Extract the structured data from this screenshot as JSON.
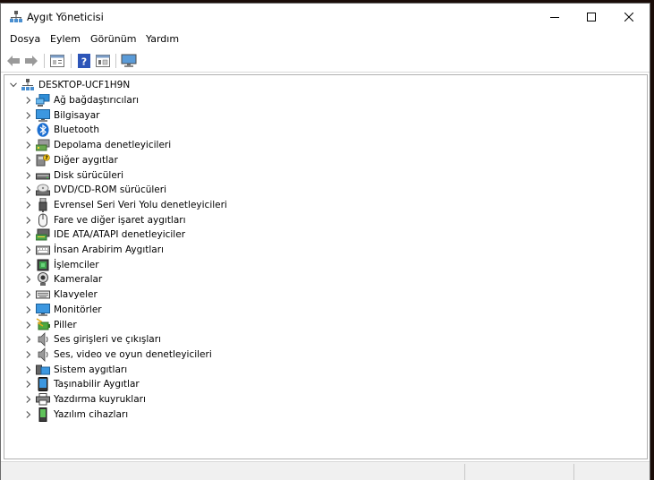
{
  "window": {
    "title": "Aygıt Yöneticisi"
  },
  "menu": [
    "Dosya",
    "Eylem",
    "Görünüm",
    "Yardım"
  ],
  "toolbar": {
    "buttons": [
      {
        "icon": "back-arrow-icon"
      },
      {
        "icon": "forward-arrow-icon"
      },
      {
        "icon": "properties-icon"
      },
      {
        "icon": "help-icon"
      },
      {
        "icon": "details-view-icon"
      },
      {
        "icon": "monitor-scan-icon"
      }
    ]
  },
  "tree": {
    "root": {
      "label": "DESKTOP-UCF1H9N",
      "icon": "computer-tree-icon"
    },
    "categories": [
      {
        "label": "Ağ bağdaştırıcıları",
        "icon": "network-adapter-icon"
      },
      {
        "label": "Bilgisayar",
        "icon": "computer-icon"
      },
      {
        "label": "Bluetooth",
        "icon": "bluetooth-icon"
      },
      {
        "label": "Depolama denetleyicileri",
        "icon": "storage-controller-icon"
      },
      {
        "label": "Diğer aygıtlar",
        "icon": "other-device-icon"
      },
      {
        "label": "Disk sürücüleri",
        "icon": "disk-drive-icon"
      },
      {
        "label": "DVD/CD-ROM sürücüleri",
        "icon": "dvd-icon"
      },
      {
        "label": "Evrensel Seri Veri Yolu denetleyicileri",
        "icon": "usb-icon"
      },
      {
        "label": "Fare ve diğer işaret aygıtları",
        "icon": "mouse-icon"
      },
      {
        "label": "IDE ATA/ATAPI denetleyiciler",
        "icon": "ide-icon"
      },
      {
        "label": "İnsan Arabirim Aygıtları",
        "icon": "hid-icon"
      },
      {
        "label": "İşlemciler",
        "icon": "processor-icon"
      },
      {
        "label": "Kameralar",
        "icon": "camera-icon"
      },
      {
        "label": "Klavyeler",
        "icon": "keyboard-icon"
      },
      {
        "label": "Monitörler",
        "icon": "monitor-icon"
      },
      {
        "label": "Piller",
        "icon": "battery-icon"
      },
      {
        "label": "Ses girişleri ve çıkışları",
        "icon": "audio-io-icon"
      },
      {
        "label": "Ses, video ve oyun denetleyicileri",
        "icon": "sound-video-icon"
      },
      {
        "label": "Sistem aygıtları",
        "icon": "system-device-icon"
      },
      {
        "label": "Taşınabilir Aygıtlar",
        "icon": "portable-device-icon"
      },
      {
        "label": "Yazdırma kuyrukları",
        "icon": "printer-icon"
      },
      {
        "label": "Yazılım cihazları",
        "icon": "software-device-icon"
      }
    ]
  },
  "colors": {
    "accent": "#0a76c8",
    "tree_border": "#b0b0b0",
    "statusbar": "#f0f0f0"
  }
}
